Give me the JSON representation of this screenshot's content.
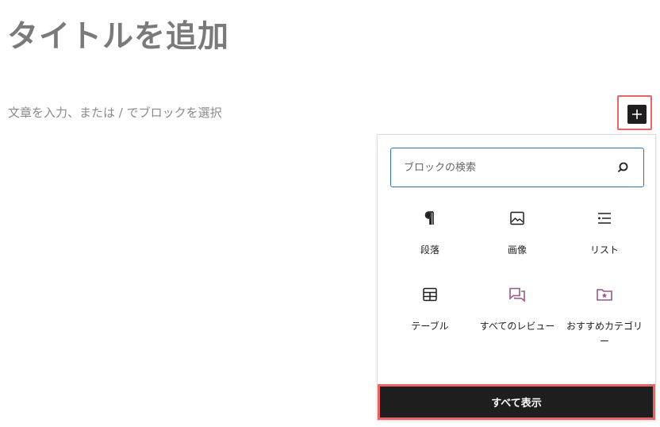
{
  "editor": {
    "title_placeholder": "タイトルを追加",
    "body_placeholder": "文章を入力、または / でブロックを選択"
  },
  "inserter": {
    "search_placeholder": "ブロックの検索",
    "blocks": [
      {
        "label": "段落",
        "icon": "paragraph-icon"
      },
      {
        "label": "画像",
        "icon": "image-icon"
      },
      {
        "label": "リスト",
        "icon": "list-icon"
      },
      {
        "label": "テーブル",
        "icon": "table-icon"
      },
      {
        "label": "すべてのレビュー",
        "icon": "reviews-icon"
      },
      {
        "label": "おすすめカテゴリー",
        "icon": "featured-category-icon"
      }
    ],
    "show_all_label": "すべて表示"
  },
  "colors": {
    "accent": "#2a78b7",
    "dark": "#1e1e1e",
    "highlight": "#e76565",
    "woo_purple": "#96588a"
  }
}
